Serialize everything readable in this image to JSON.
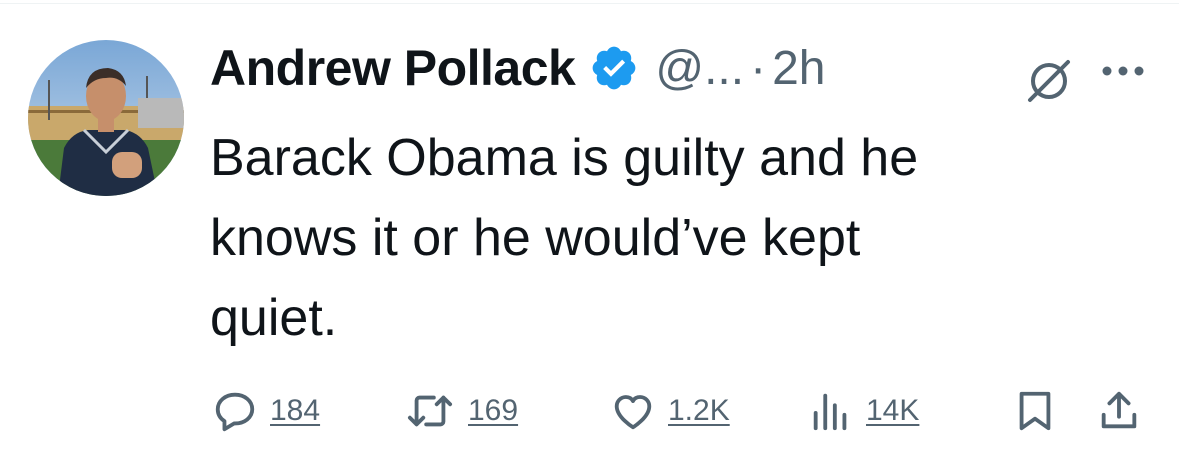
{
  "tweet": {
    "author_name": "Andrew Pollack",
    "handle": "@...",
    "separator": "·",
    "time": "2h",
    "verified": true,
    "verified_color": "#1d9bf0",
    "text": "Barack Obama is guilty and he\nknows it or he would’ve kept\nquiet."
  },
  "header_icons": {
    "grok": "grok-slash-circle-icon",
    "more": "more-dots-icon"
  },
  "actions": {
    "reply": {
      "icon": "reply-bubble-icon",
      "count": "184"
    },
    "retweet": {
      "icon": "retweet-arrows-icon",
      "count": "169"
    },
    "like": {
      "icon": "heart-icon",
      "count": "1.2K"
    },
    "views": {
      "icon": "views-bars-icon",
      "count": "14K"
    },
    "bookmark": {
      "icon": "bookmark-icon"
    },
    "share": {
      "icon": "share-upload-icon"
    }
  },
  "colors": {
    "text": "#0f1419",
    "secondary": "#536471",
    "accent": "#1d9bf0"
  }
}
